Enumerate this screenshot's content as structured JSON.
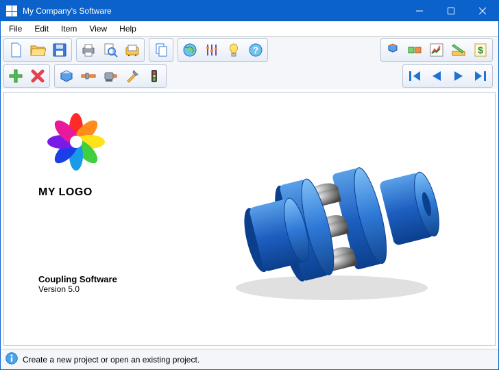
{
  "window": {
    "title": "My Company's Software"
  },
  "menu": {
    "file": "File",
    "edit": "Edit",
    "item": "Item",
    "view": "View",
    "help": "Help"
  },
  "splash": {
    "logo_text": "MY LOGO",
    "product_name": "Coupling Software",
    "version": "Version 5.0"
  },
  "status": {
    "message": "Create a new project or open an existing project."
  },
  "icons": {
    "new": "new-file",
    "open": "open-folder",
    "save": "save-disk",
    "print": "printer",
    "preview": "magnifier",
    "contacts": "rolodex",
    "copy": "copy-pages",
    "globe": "globe",
    "equalizer": "equalizer",
    "idea": "lightbulb",
    "help": "help-question",
    "cube1": "cube-stack",
    "cube2": "cube-row",
    "chart": "chart",
    "pencil": "pencil-ruler",
    "money": "dollar",
    "add": "plus",
    "delete": "x-red",
    "box": "box3d",
    "shaft": "shaft",
    "motor": "motor",
    "tools": "screwdriver-wrench",
    "traffic": "traffic-light",
    "first": "nav-first",
    "prev": "nav-prev",
    "next": "nav-next",
    "last": "nav-last"
  }
}
